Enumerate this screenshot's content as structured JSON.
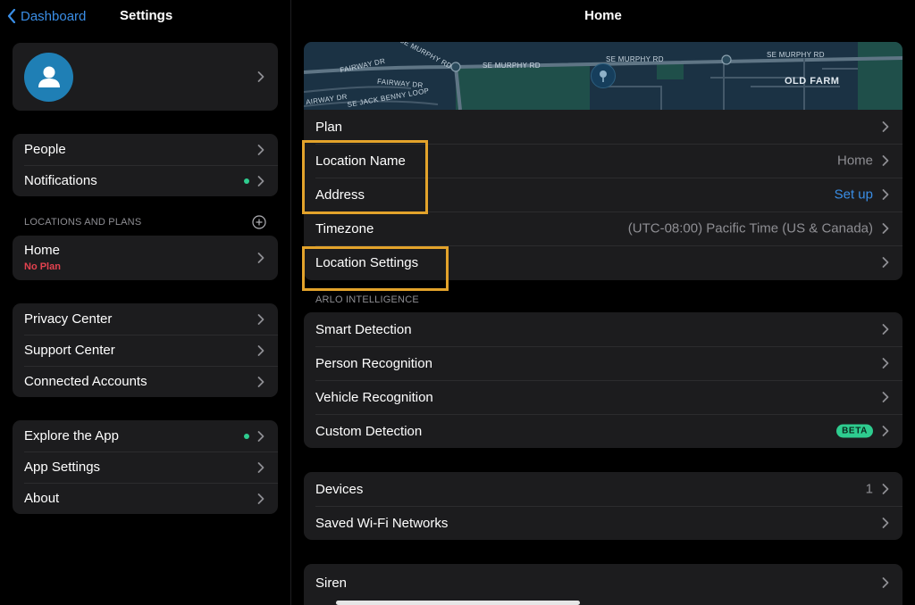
{
  "sidebar": {
    "back_label": "Dashboard",
    "title": "Settings",
    "group1": [
      {
        "label": "People",
        "dot": false
      },
      {
        "label": "Notifications",
        "dot": true
      }
    ],
    "section_header": "LOCATIONS AND PLANS",
    "location": {
      "label": "Home",
      "sub": "No Plan"
    },
    "group2": [
      {
        "label": "Privacy Center"
      },
      {
        "label": "Support Center"
      },
      {
        "label": "Connected Accounts"
      }
    ],
    "group3": [
      {
        "label": "Explore the App",
        "dot": true
      },
      {
        "label": "App Settings",
        "dot": false
      },
      {
        "label": "About",
        "dot": false
      }
    ]
  },
  "main": {
    "title": "Home",
    "map": {
      "streets": [
        "SE MURPHY RD",
        "SE MURPHY RD",
        "SE MURPHY RD",
        "SE MURPHY RD",
        "FAIRWAY DR",
        "SE JACK BENNY LOOP",
        "FAIRWAY DR",
        "AIRWAY DR"
      ],
      "area_label": "OLD FARM"
    },
    "location_rows": [
      {
        "label": "Plan",
        "value": ""
      },
      {
        "label": "Location Name",
        "value": "Home"
      },
      {
        "label": "Address",
        "value": "Set up"
      },
      {
        "label": "Timezone",
        "value": "(UTC-08:00) Pacific Time (US & Canada)"
      },
      {
        "label": "Location Settings",
        "value": ""
      }
    ],
    "intel_header": "ARLO INTELLIGENCE",
    "intel_rows": [
      {
        "label": "Smart Detection"
      },
      {
        "label": "Person Recognition"
      },
      {
        "label": "Vehicle Recognition"
      },
      {
        "label": "Custom Detection",
        "badge": "BETA"
      }
    ],
    "device_rows": [
      {
        "label": "Devices",
        "value": "1"
      },
      {
        "label": "Saved Wi-Fi Networks",
        "value": ""
      }
    ],
    "siren_label": "Siren"
  },
  "colors": {
    "accent": "#3a8ee6",
    "highlight": "#e3a32b",
    "status_dot": "#2ecc8f",
    "no_plan": "#e3424f",
    "card": "#1c1c1e"
  }
}
